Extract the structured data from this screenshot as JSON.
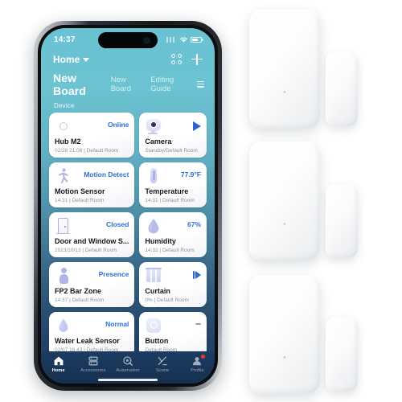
{
  "phone": {
    "status_bar": {
      "time": "14:37",
      "wifi_icon": "wifi-icon",
      "battery_icon": "battery-icon",
      "signal_icon": "signal-icon"
    },
    "top_bar": {
      "home_label": "Home",
      "caret_icon": "chevron-down-icon",
      "grid_icon": "grid-view-icon",
      "add_icon": "plus-icon"
    },
    "board": {
      "active_tab": "New Board",
      "tabs": [
        "New Board",
        "Editing Guide"
      ],
      "menu_icon": "hamburger-menu-icon",
      "section_label": "Device"
    },
    "devices": [
      {
        "title": "Hub M2",
        "state": "Online",
        "sub": "02/28 21:08 | Default Room",
        "icon": "hub-icon",
        "control": "none"
      },
      {
        "title": "Camera",
        "state": "",
        "sub": "Standby/Default Room",
        "icon": "camera-icon",
        "control": "play"
      },
      {
        "title": "Motion Sensor",
        "state": "Motion Detect",
        "sub": "14:31 | Default Room",
        "icon": "motion-sensor-icon",
        "control": "none"
      },
      {
        "title": "Temperature",
        "state": "77.9°F",
        "sub": "14:31 | Default Room",
        "icon": "thermometer-icon",
        "control": "none"
      },
      {
        "title": "Door and Window S...",
        "state": "Closed",
        "sub": "2023/10/13 | Default Room",
        "icon": "door-sensor-icon",
        "control": "none"
      },
      {
        "title": "Humidity",
        "state": "67%",
        "sub": "14:32 | Default Room",
        "icon": "humidity-drop-icon",
        "control": "none"
      },
      {
        "title": "FP2 Bar Zone",
        "state": "Presence",
        "sub": "14:37 | Default Room",
        "icon": "presence-person-icon",
        "control": "none"
      },
      {
        "title": "Curtain",
        "state": "",
        "sub": "0% | Default Room",
        "icon": "curtain-icon",
        "control": "curtain"
      },
      {
        "title": "Water Leak Sensor",
        "state": "Normal",
        "sub": "02/07 18:43 | Default Room",
        "icon": "water-drop-icon",
        "control": "none"
      },
      {
        "title": "Button",
        "state": "",
        "sub": "Default Room",
        "icon": "button-icon",
        "control": "dash"
      }
    ],
    "bottom_nav": [
      {
        "label": "Home",
        "icon": "home-icon",
        "active": true,
        "badge": false
      },
      {
        "label": "Accessories",
        "icon": "accessories-icon",
        "active": false,
        "badge": false
      },
      {
        "label": "Automation",
        "icon": "automation-icon",
        "active": false,
        "badge": false
      },
      {
        "label": "Scene",
        "icon": "scene-icon",
        "active": false,
        "badge": false
      },
      {
        "label": "Profile",
        "icon": "profile-icon",
        "active": false,
        "badge": true
      }
    ]
  },
  "products": {
    "count": 3,
    "name": "door-and-window-sensor",
    "items": [
      {
        "label": "door-window-sensor-unit-1"
      },
      {
        "label": "door-window-sensor-unit-2"
      },
      {
        "label": "door-window-sensor-unit-3"
      }
    ]
  },
  "colors": {
    "accent_blue": "#2c6fd1",
    "screen_top": "#69c2d2",
    "screen_bottom": "#1d3a60",
    "nav_bar": "#1c3c63",
    "badge_red": "#e8372b",
    "product_white": "#ffffff"
  }
}
